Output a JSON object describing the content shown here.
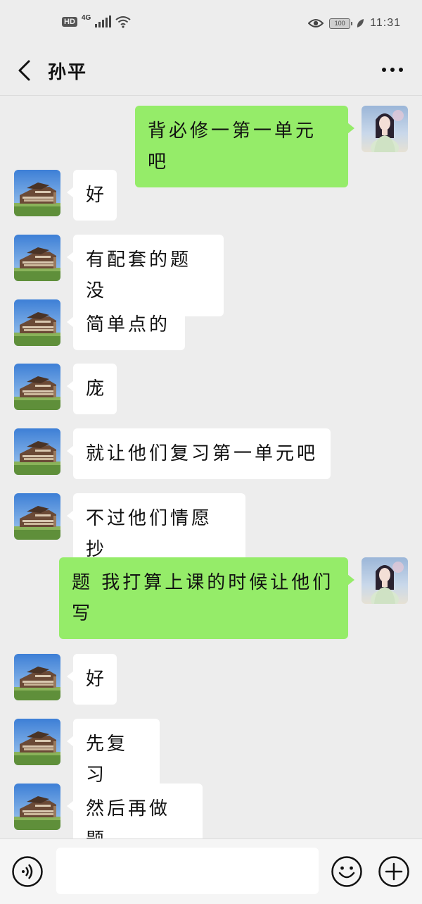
{
  "status_bar": {
    "hd": "HD",
    "network": "4G",
    "battery": "100",
    "time": "11:31",
    "icons": [
      "signal-icon",
      "wifi-icon",
      "eye-icon",
      "battery-icon",
      "leaf-icon"
    ]
  },
  "header": {
    "title": "孙平",
    "back_icon": "chevron-left-icon",
    "more_icon": "more-dots-icon"
  },
  "messages": [
    {
      "side": "right",
      "text": "背必修一第一单元吧"
    },
    {
      "side": "left",
      "text": "好"
    },
    {
      "side": "left",
      "text": "有配套的题没"
    },
    {
      "side": "left",
      "text": "简单点的"
    },
    {
      "side": "left",
      "text": "庞"
    },
    {
      "side": "left",
      "text": "就让他们复习第一单元吧"
    },
    {
      "side": "left",
      "text": "不过他们情愿抄"
    },
    {
      "side": "right",
      "text": "题 我打算上课的时候让他们写"
    },
    {
      "side": "left",
      "text": "好"
    },
    {
      "side": "left",
      "text": "先复习"
    },
    {
      "side": "left",
      "text": "然后再做题"
    }
  ],
  "input_bar": {
    "placeholder": "",
    "voice_icon": "voice-icon",
    "emoji_icon": "emoji-icon",
    "plus_icon": "plus-icon"
  },
  "colors": {
    "background": "#ededed",
    "bubble_self": "#95ec69",
    "bubble_other": "#ffffff"
  }
}
